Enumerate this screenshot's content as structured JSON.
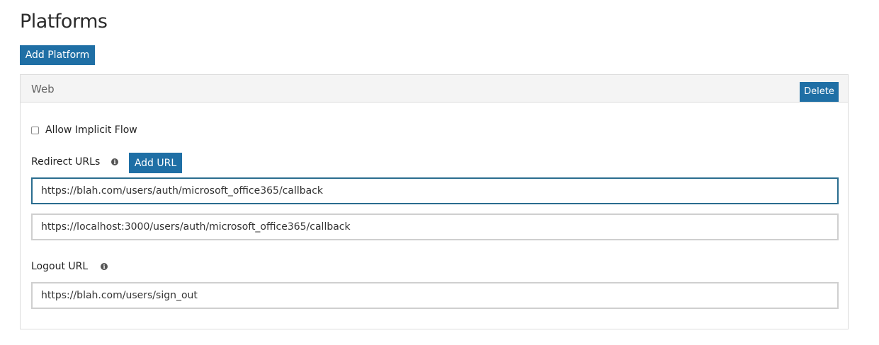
{
  "page": {
    "title": "Platforms",
    "add_platform_label": "Add Platform"
  },
  "platform": {
    "title": "Web",
    "delete_label": "Delete",
    "allow_implicit_flow_label": "Allow Implicit Flow",
    "allow_implicit_flow_checked": false,
    "redirect_urls_label": "Redirect URLs",
    "add_url_label": "Add URL",
    "redirect_urls": [
      "https://blah.com/users/auth/microsoft_office365/callback",
      "https://localhost:3000/users/auth/microsoft_office365/callback"
    ],
    "logout_url_label": "Logout URL",
    "logout_url": "https://blah.com/users/sign_out"
  },
  "icons": {
    "info": "info-icon"
  },
  "colors": {
    "button_bg": "#1f6fa5",
    "focus_border": "#2a6d8f"
  }
}
